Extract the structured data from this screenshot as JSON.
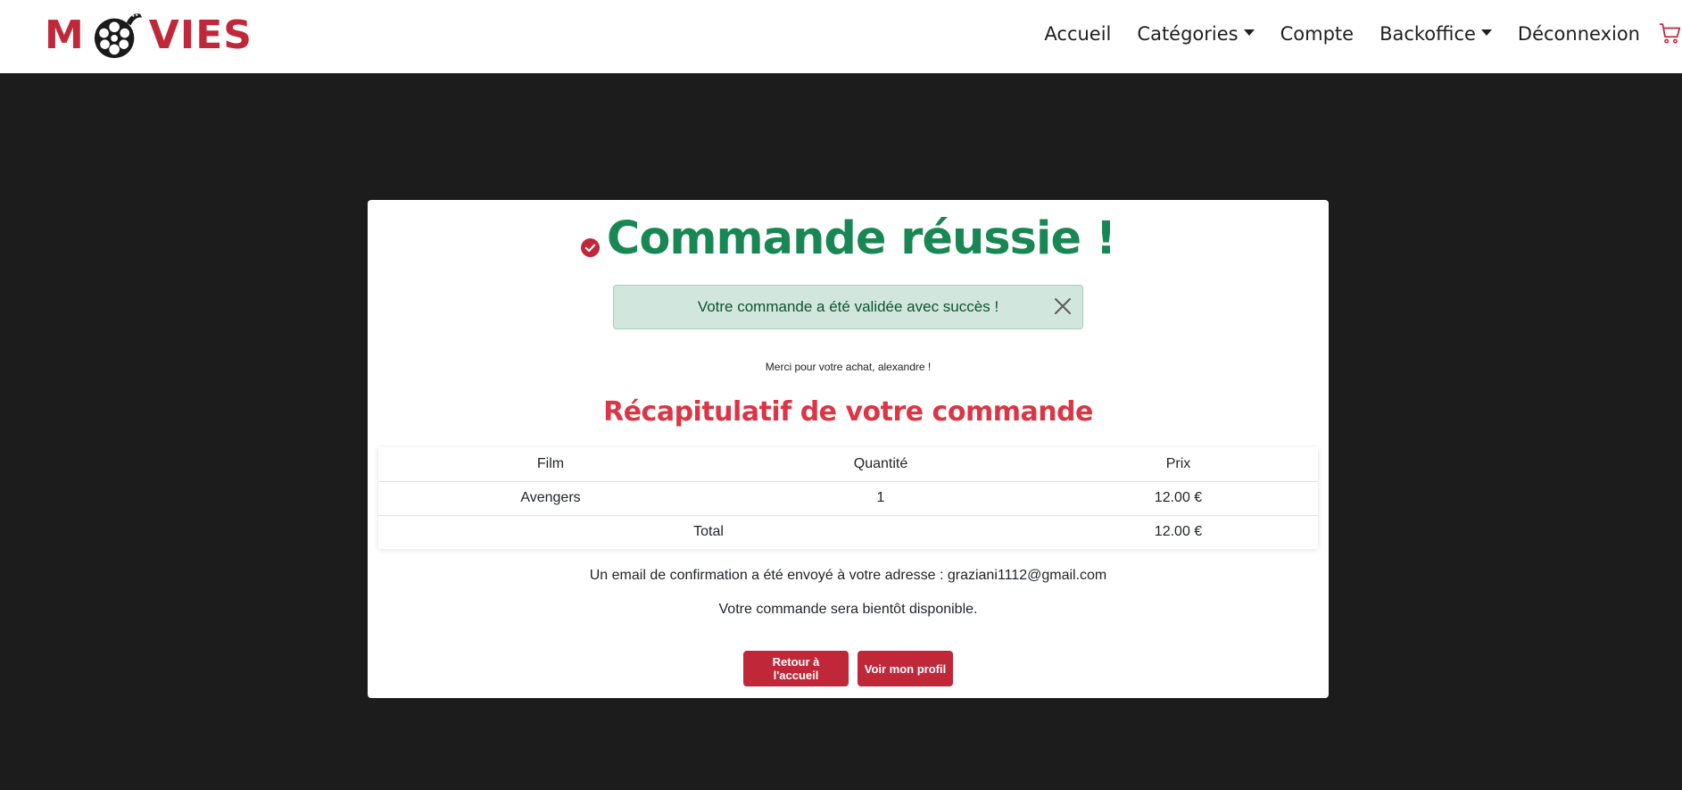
{
  "navbar": {
    "brand_left": "M",
    "brand_right": "VIES",
    "links": {
      "home": "Accueil",
      "categories": "Catégories",
      "account": "Compte",
      "backoffice": "Backoffice",
      "logout": "Déconnexion"
    },
    "icons": {
      "logo": "film-reel-icon",
      "cart": "cart-icon"
    }
  },
  "main": {
    "title": "Commande réussie !",
    "alert_message": "Votre commande a été validée avec succès !",
    "thanks_message": "Merci pour votre achat, alexandre !",
    "recap_title": "Récapitulatif de votre commande",
    "table": {
      "headers": [
        "Film",
        "Quantité",
        "Prix"
      ],
      "rows": [
        {
          "film": "Avengers",
          "quantity": "1",
          "price": "12.00 €"
        }
      ],
      "total_label": "Total",
      "total_value": "12.00 €"
    },
    "email_message": "Un email de confirmation a été envoyé à votre adresse : graziani1112@gmail.com",
    "availability_message": "Votre commande sera bientôt disponible.",
    "buttons": {
      "home": "Retour à l'accueil",
      "profile": "Voir mon profil"
    }
  },
  "colors": {
    "brand": "#c0283a",
    "success": "#198754",
    "recap": "#dc3545",
    "alert_bg": "#d1e7dd",
    "page_bg": "#1c1c1c"
  }
}
